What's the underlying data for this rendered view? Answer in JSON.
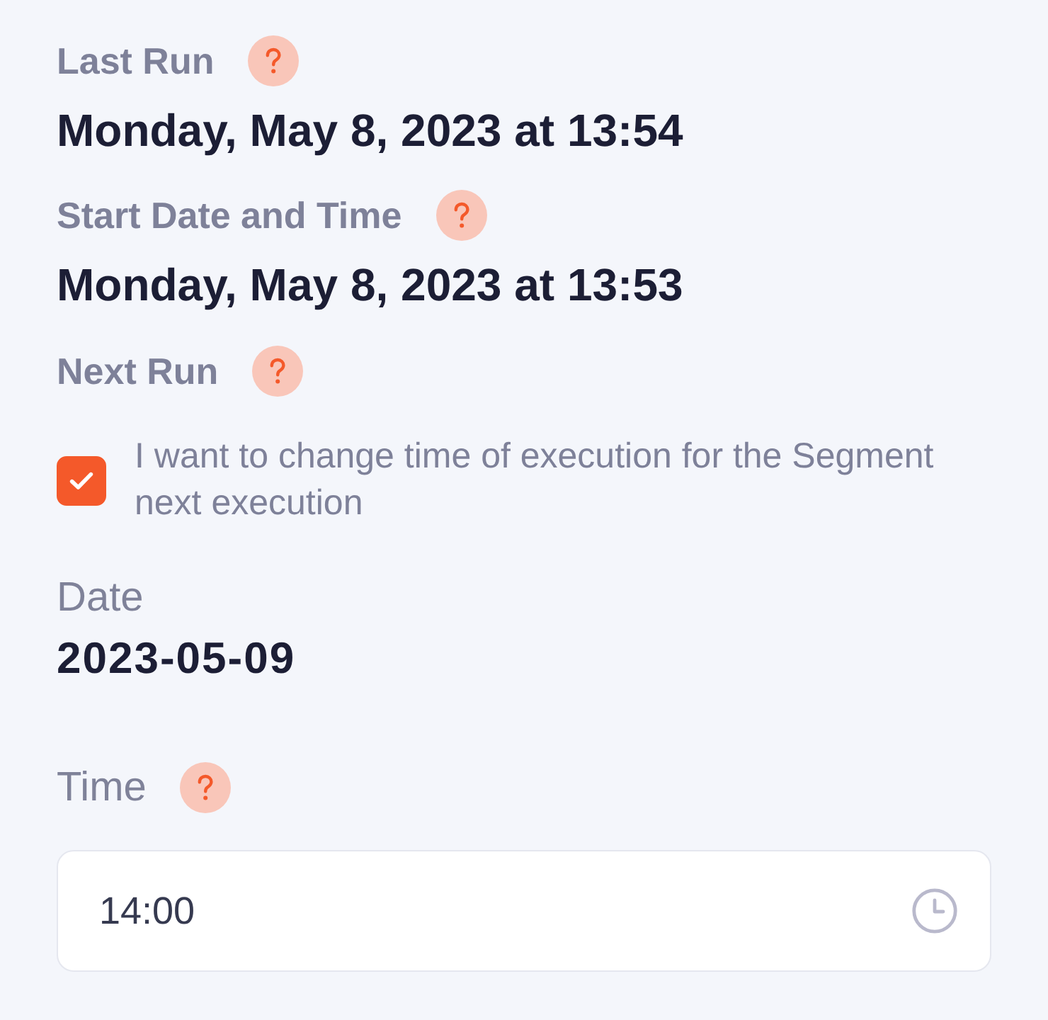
{
  "sections": [
    {
      "kind": "info",
      "label": "Last Run",
      "help": true,
      "value": "Monday, May 8, 2023 at 13:54"
    },
    {
      "kind": "info",
      "label": "Start Date and Time",
      "help": true,
      "value": "Monday, May 8, 2023 at 13:53"
    },
    {
      "kind": "heading",
      "label": "Next Run",
      "help": true
    },
    {
      "kind": "checkbox",
      "label": "I want to change time of execution for the Segment next execution",
      "checked": true
    },
    {
      "kind": "date",
      "label": "Date",
      "help": false,
      "value": "2023-05-09"
    },
    {
      "kind": "time-input",
      "label": "Time",
      "help": true,
      "value": "14:00"
    }
  ]
}
